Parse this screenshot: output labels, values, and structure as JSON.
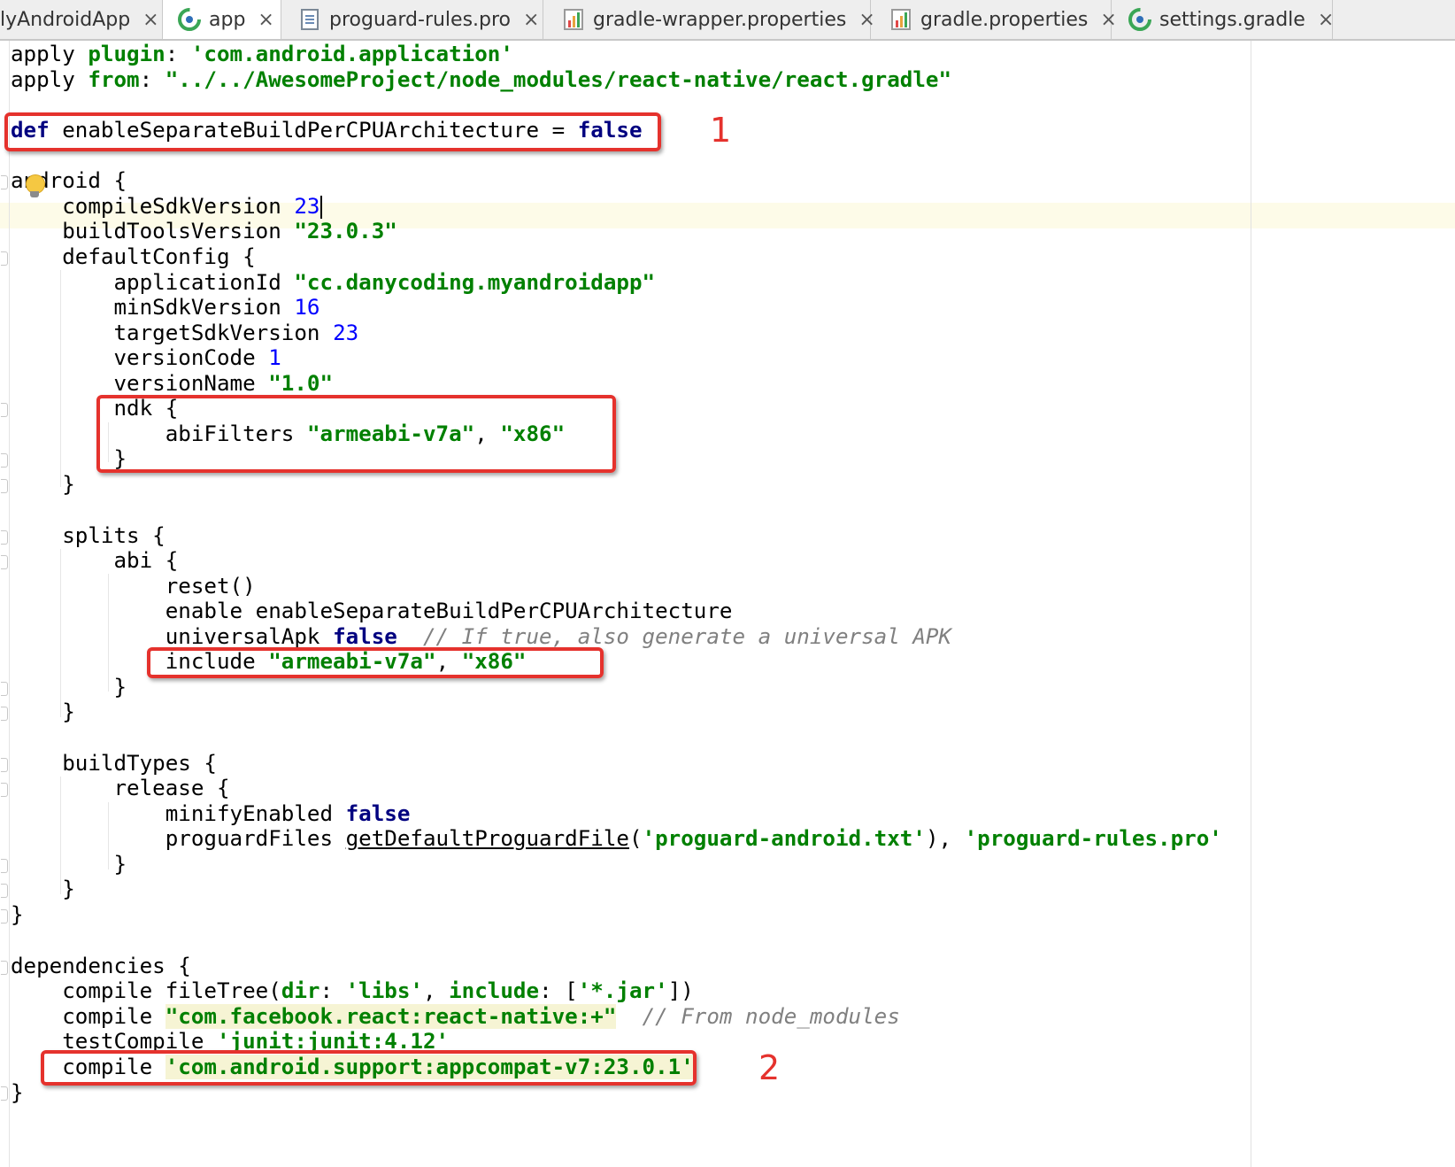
{
  "tabs": [
    {
      "label": "lyAndroidApp",
      "icon": "none",
      "active": false
    },
    {
      "label": "app",
      "icon": "gradle-module-icon",
      "active": true
    },
    {
      "label": "proguard-rules.pro",
      "icon": "text-file-icon",
      "active": false
    },
    {
      "label": "gradle-wrapper.properties",
      "icon": "properties-file-icon",
      "active": false
    },
    {
      "label": "gradle.properties",
      "icon": "properties-file-icon",
      "active": false
    },
    {
      "label": "settings.gradle",
      "icon": "gradle-module-icon",
      "active": false
    }
  ],
  "tab_close_glyph": "×",
  "code": {
    "l1": {
      "a": "apply ",
      "b": "plugin",
      "c": ": ",
      "d": "'com.android.application'"
    },
    "l2": {
      "a": "apply ",
      "b": "from",
      "c": ": ",
      "d": "\"../../AwesomeProject/node_modules/react-native/react.gradle\""
    },
    "l4": {
      "a": "def",
      "b": " enableSeparateBuildPerCPUArchitecture = ",
      "c": "false"
    },
    "l6": {
      "a": "android {"
    },
    "l7": {
      "a": "    compileSdkVersion ",
      "b": "23"
    },
    "l8": {
      "a": "    buildToolsVersion ",
      "b": "\"23.0.3\""
    },
    "l9": {
      "a": "    defaultConfig {"
    },
    "l10": {
      "a": "        applicationId ",
      "b": "\"cc.danycoding.myandroidapp\""
    },
    "l11": {
      "a": "        minSdkVersion ",
      "b": "16"
    },
    "l12": {
      "a": "        targetSdkVersion ",
      "b": "23"
    },
    "l13": {
      "a": "        versionCode ",
      "b": "1"
    },
    "l14": {
      "a": "        versionName ",
      "b": "\"1.0\""
    },
    "l15": {
      "a": "        ndk {"
    },
    "l16": {
      "a": "            abiFilters ",
      "b": "\"armeabi-v7a\"",
      "c": ", ",
      "d": "\"x86\""
    },
    "l17": {
      "a": "        }"
    },
    "l18": {
      "a": "    }"
    },
    "l20": {
      "a": "    splits {"
    },
    "l21": {
      "a": "        abi {"
    },
    "l22": {
      "a": "            reset()"
    },
    "l23": {
      "a": "            enable enableSeparateBuildPerCPUArchitecture"
    },
    "l24": {
      "a": "            universalApk ",
      "b": "false",
      "c": "  ",
      "d": "// If true, also generate a universal APK"
    },
    "l25": {
      "a": "            include ",
      "b": "\"armeabi-v7a\"",
      "c": ", ",
      "d": "\"x86\""
    },
    "l26": {
      "a": "        }"
    },
    "l27": {
      "a": "    }"
    },
    "l29": {
      "a": "    buildTypes {"
    },
    "l30": {
      "a": "        release {"
    },
    "l31": {
      "a": "            minifyEnabled ",
      "b": "false"
    },
    "l32": {
      "a": "            proguardFiles ",
      "b": "getDefaultProguardFile",
      "c": "(",
      "d": "'proguard-android.txt'",
      "e": "), ",
      "f": "'proguard-rules.pro'"
    },
    "l33": {
      "a": "        }"
    },
    "l34": {
      "a": "    }"
    },
    "l35": {
      "a": "}"
    },
    "l37": {
      "a": "dependencies {"
    },
    "l38": {
      "a": "    compile fileTree(",
      "b": "dir",
      "c": ": ",
      "d": "'libs'",
      "e": ", ",
      "f": "include",
      "g": ": [",
      "h": "'*.jar'",
      "i": "])"
    },
    "l39": {
      "a": "    compile ",
      "b": "\"com.facebook.react:react-native:+\"",
      "c": "  ",
      "d": "// From node_modules"
    },
    "l40": {
      "a": "    testCompile ",
      "b": "'junit:junit:4.12'"
    },
    "l41": {
      "a": "    compile ",
      "b": "'com.android.support:appcompat-v7:23.0.1'"
    },
    "l42": {
      "a": "}"
    }
  },
  "annotations": {
    "label_1": "1",
    "label_2": "2"
  },
  "colors": {
    "annotation": "#e5322d",
    "keyword": "#000080",
    "string": "#008000",
    "number": "#0000ff",
    "comment": "#808080"
  }
}
